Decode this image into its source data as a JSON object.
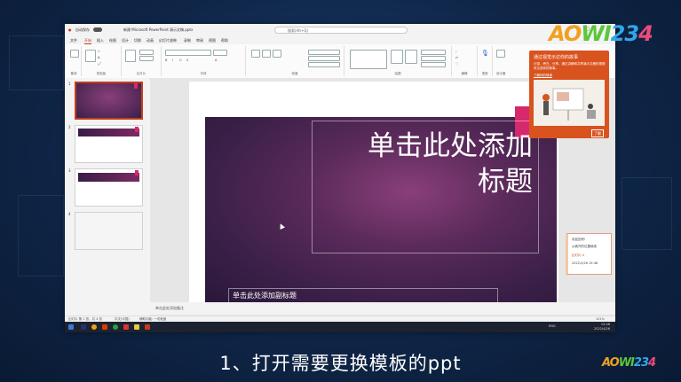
{
  "app": {
    "autosave_label": "自动保存",
    "file_title": "新建 Microsoft PowerPoint 演示文稿.pptx",
    "search_placeholder": "搜索(Alt+Q)"
  },
  "menu": [
    "文件",
    "开始",
    "插入",
    "绘图",
    "设计",
    "切换",
    "动画",
    "幻灯片放映",
    "录制",
    "审阅",
    "视图",
    "帮助"
  ],
  "ribbon_groups": [
    "撤消",
    "剪贴板",
    "幻灯片",
    "字体",
    "段落",
    "绘图",
    "编辑",
    "语音",
    "设计器"
  ],
  "slides": [
    {
      "num": "1"
    },
    {
      "num": "2"
    },
    {
      "num": "3"
    },
    {
      "num": "4"
    }
  ],
  "slide": {
    "title_line1": "单击此处添加",
    "title_line2": "标题",
    "subtitle": "单击此处添加副标题"
  },
  "notes_placeholder": "单击此处添加备注",
  "status": {
    "slide_count": "幻灯片 第 1 张，共 4 张",
    "language": "中文(中国)",
    "accessibility": "辅助功能: 一切就绪",
    "zoom": "101%"
  },
  "popup": {
    "title": "通过视觉示达你的故事",
    "body": "记录、旁白、分享。通过讲解和共享演示文稿的视频来达成你的故事。",
    "link": "了解你的故事",
    "button": "了解"
  },
  "comment": {
    "line1": "欢迎回来!",
    "line2": "从离开的位置继续",
    "line3": "幻灯片 4",
    "time": "2022/4/26  15:48"
  },
  "taskbar": {
    "time": "15:48",
    "date": "2022/4/26",
    "ime": "ENG"
  },
  "caption": "1、打开需要更换模板的ppt",
  "logo": {
    "text": "AOWI234",
    "small": "AOWI234"
  },
  "colors": {
    "accent": "#c43e1c",
    "slide_pink": "#d6286d",
    "popup": "#d9531e"
  }
}
